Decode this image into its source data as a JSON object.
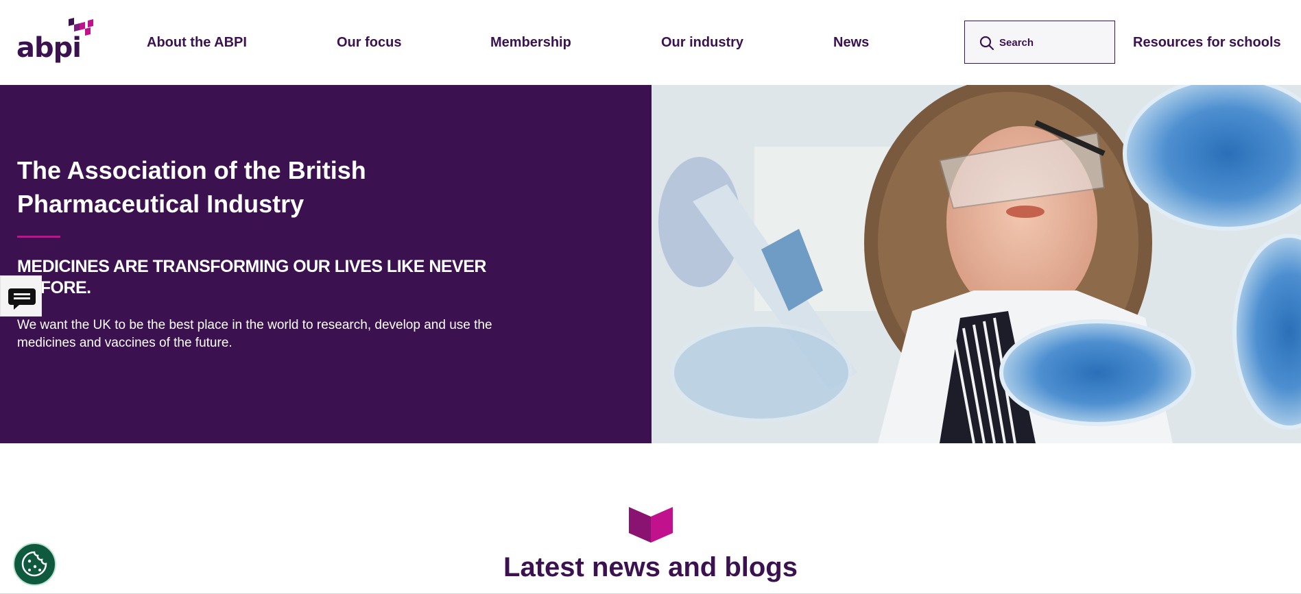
{
  "header": {
    "logo_text": "abpi",
    "nav": [
      {
        "label": "About the ABPI"
      },
      {
        "label": "Our focus"
      },
      {
        "label": "Membership"
      },
      {
        "label": "Our industry"
      },
      {
        "label": "News"
      }
    ],
    "search": {
      "placeholder": "Search",
      "icon": "search-icon"
    },
    "resources_link": "Resources for schools"
  },
  "hero": {
    "title": "The Association of the British Pharmaceutical Industry",
    "tagline": "MEDICINES ARE TRANSFORMING OUR LIVES LIKE NEVER BEFORE.",
    "body": "We want the UK to be the best place in the world to research, develop and use the medicines and vaccines of the future.",
    "image_subject": "scientist with pipette and blue petri dishes"
  },
  "chat": {
    "icon": "chat-bubble-icon"
  },
  "cookie": {
    "icon": "cookie-icon"
  },
  "latest": {
    "heading": "Latest news and blogs",
    "icon": "open-book-icon"
  },
  "colors": {
    "brand_purple": "#3b1150",
    "brand_magenta": "#c1118c",
    "cookie_green": "#0f5a3f",
    "search_bg": "#f6f5f7"
  }
}
